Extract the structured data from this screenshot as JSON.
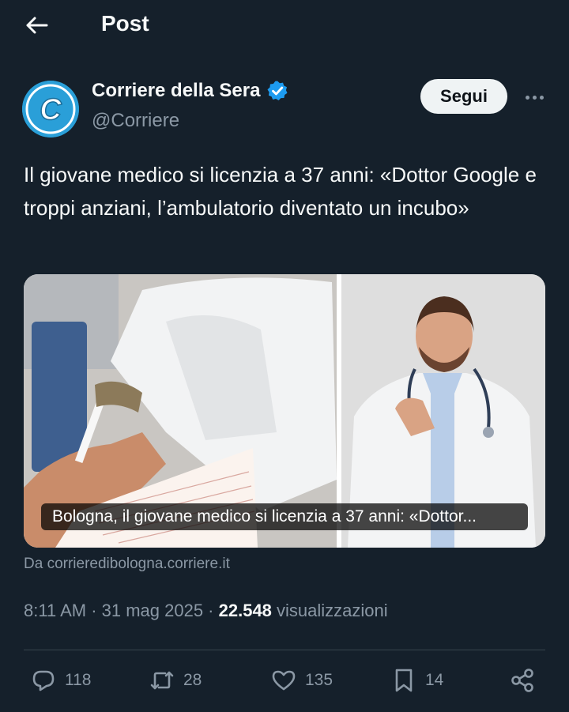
{
  "header": {
    "title": "Post"
  },
  "author": {
    "name": "Corriere della Sera",
    "handle": "@Corriere",
    "avatar_letter": "C"
  },
  "follow_label": "Segui",
  "post": {
    "text": "Il giovane medico si licenzia a 37 anni: «Dottor Google e troppi anziani, l’ambulatorio diventato un incubo»"
  },
  "card": {
    "caption": "Bologna, il giovane medico si licenzia a 37 anni: «Dottor...",
    "source": "Da corrieredibologna.corriere.it"
  },
  "meta": {
    "time_date": "8:11 AM · 31 mag 2025 · ",
    "views": "22.548",
    "views_label": " visualizzazioni"
  },
  "actions": {
    "replies": "118",
    "reposts": "28",
    "likes": "135",
    "bookmarks": "14"
  },
  "colors": {
    "background": "#15202b",
    "verified": "#1d9bf0",
    "muted": "#8b98a5"
  }
}
